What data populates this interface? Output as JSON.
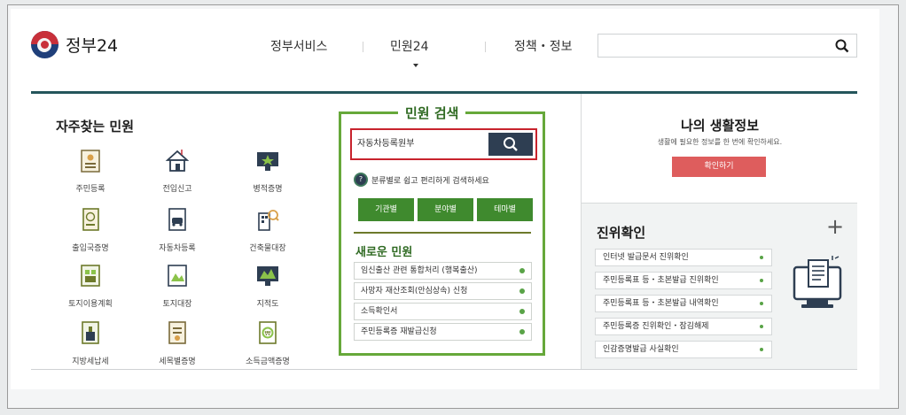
{
  "header": {
    "logo_text": "정부24",
    "nav": [
      {
        "label": "정부서비스",
        "active": false
      },
      {
        "label": "민원24",
        "active": true
      },
      {
        "label": "정책・정보",
        "active": false
      }
    ],
    "search_value": "",
    "colors": {
      "accent": "#24555b",
      "logo_red": "#c8303a",
      "logo_blue": "#1f3f7a"
    }
  },
  "frequent": {
    "title": "자주찾는 민원",
    "items": [
      {
        "label": "주민등록",
        "icon": "resident-card-icon"
      },
      {
        "label": "전입신고",
        "icon": "house-move-icon"
      },
      {
        "label": "병적증명",
        "icon": "military-record-icon"
      },
      {
        "label": "출입국증명",
        "icon": "passport-icon"
      },
      {
        "label": "자동차등록",
        "icon": "car-registration-icon"
      },
      {
        "label": "건축물대장",
        "icon": "building-search-icon"
      },
      {
        "label": "토지이용계획",
        "icon": "land-plan-icon"
      },
      {
        "label": "토지대장",
        "icon": "land-register-icon"
      },
      {
        "label": "지적도",
        "icon": "cadastral-map-icon"
      },
      {
        "label": "지방세납세",
        "icon": "tax-payment-icon"
      },
      {
        "label": "세목별증명",
        "icon": "tax-document-icon"
      },
      {
        "label": "소득금액증명",
        "icon": "income-certificate-icon"
      }
    ]
  },
  "civil_search": {
    "title": "민원 검색",
    "query": "자동차등록원부",
    "hint": "분류별로 쉽고 편리하게 검색하세요",
    "categories": [
      "기관별",
      "분야별",
      "테마별"
    ],
    "new_title": "새로운 민원",
    "new_items": [
      "임신출산 관련 통합처리 (행복출산)",
      "사망자 재산조회(안심상속) 신청",
      "소득확인서",
      "주민등록증 재발급신청"
    ],
    "colors": {
      "border": "#66a83a",
      "button": "#3f8a2e",
      "search_border": "#c8232d",
      "search_button": "#2e3e52"
    }
  },
  "my_info": {
    "title": "나의 생활정보",
    "subtitle": "생활에 필요한 정보를 한 번에 확인하세요.",
    "button": "확인하기",
    "button_color": "#de5d5d"
  },
  "verification": {
    "title": "진위확인",
    "plus": "+",
    "items": [
      "인터넷 발급문서 진위확인",
      "주민등록표 등・초본발급 진위확인",
      "주민등록표 등・초본발급 내역확인",
      "주민등록증 진위확인・잠김해제",
      "인감증명발급 사실확인"
    ]
  }
}
